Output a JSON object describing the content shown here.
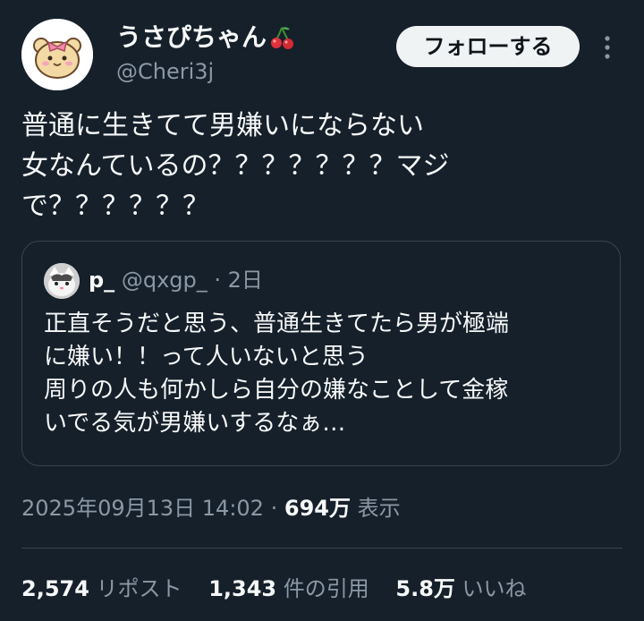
{
  "author": {
    "display_name": "うさぴちゃん",
    "emoji_icon": "cherry-icon",
    "handle": "@Cheri3j",
    "avatar_icon": "hamster-avatar"
  },
  "follow_label": "フォローする",
  "more_icon": "more-vertical-icon",
  "tweet_text": "普通に生きてて男嫌いにならない\n女なんているの？？？？？？？マジ\nで？？？？？？",
  "quoted": {
    "name": "p_",
    "handle": "@qxgp_",
    "separator": "·",
    "time": "2日",
    "avatar_icon": "cat-avatar",
    "text": "正直そうだと思う、普通生きてたら男が極端\nに嫌い！！って人いないと思う\n周りの人も何かしら自分の嫌なことして金稼\nいでる気が男嫌いするなぁ…"
  },
  "meta": {
    "datetime": "2025年09月13日 14:02",
    "separator": "·",
    "views": "694万",
    "views_label": "表示"
  },
  "stats": {
    "reposts": "2,574",
    "reposts_label": "リポスト",
    "quotes": "1,343",
    "quotes_label": "件の引用",
    "likes": "5.8万",
    "likes_label": "いいね"
  },
  "colors": {
    "background": "#15202b",
    "text": "#f7f9f9",
    "secondary": "#8b98a5",
    "border": "#38444d",
    "button_bg": "#eff3f4"
  }
}
